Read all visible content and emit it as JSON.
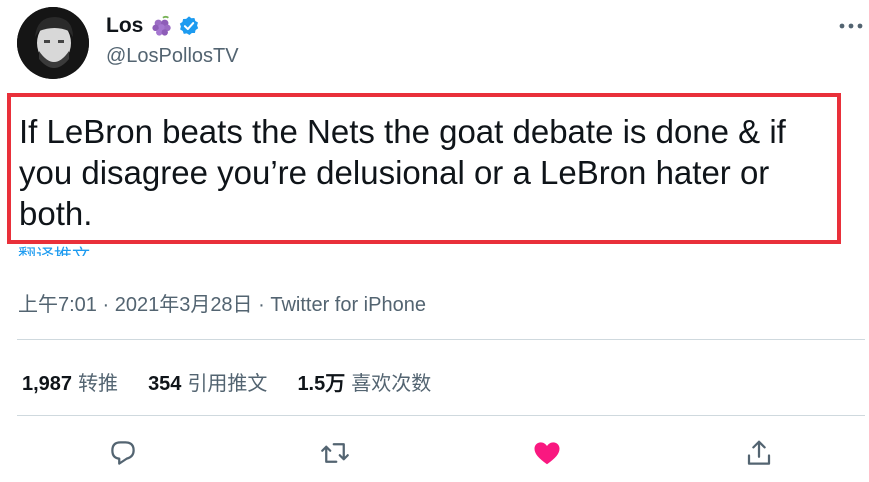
{
  "author": {
    "name": "Los",
    "handle": "@LosPollosTV"
  },
  "tweet": {
    "text": "If LeBron beats the Nets the goat debate is done & if you disagree you’re delusional or a LeBron hater or both.",
    "translate_label": "翻译推文",
    "meta": "上午7:01 · 2021年3月28日 · Twitter for iPhone"
  },
  "stats": [
    {
      "count": "1,987",
      "label": "转推"
    },
    {
      "count": "354",
      "label": "引用推文"
    },
    {
      "count": "1.5万",
      "label": "喜欢次数"
    }
  ],
  "colors": {
    "accent": "#1d9bf0",
    "like": "#f91880",
    "highlight_border": "#e9303a",
    "secondary_text": "#536471"
  },
  "icons": {
    "reply": "reply-icon",
    "retweet": "retweet-icon",
    "like": "heart-icon",
    "share": "share-icon",
    "more": "more-icon"
  }
}
